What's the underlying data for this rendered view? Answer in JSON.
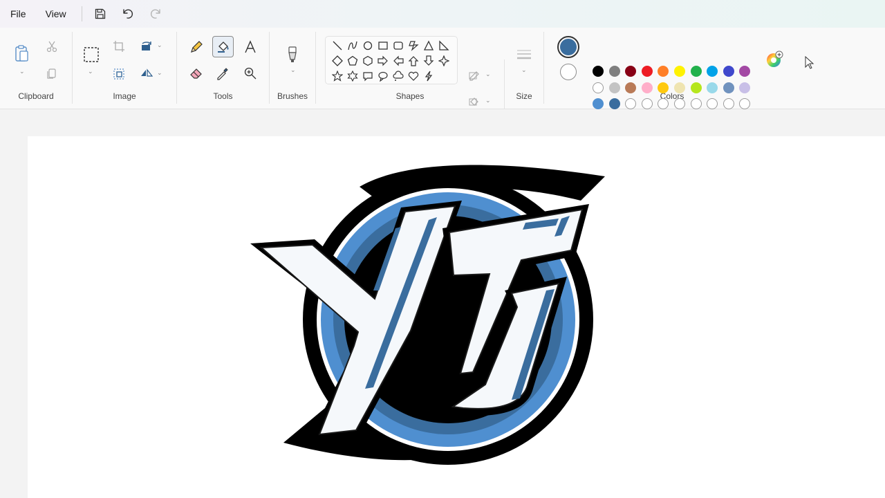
{
  "menu": {
    "file": "File",
    "view": "View"
  },
  "groups": {
    "clipboard": "Clipboard",
    "image": "Image",
    "tools": "Tools",
    "brushes": "Brushes",
    "shapes": "Shapes",
    "size": "Size",
    "colors": "Colors"
  },
  "colors": {
    "primary": "#3a6d9e",
    "secondary": "#ffffff",
    "palette_row1": [
      "#000000",
      "#7f7f7f",
      "#880015",
      "#ed1c24",
      "#ff7f27",
      "#fff200",
      "#22b14c",
      "#00a2e8",
      "#3f48cc",
      "#a349a4"
    ],
    "palette_row2": [
      "#ffffff",
      "#c3c3c3",
      "#b97a57",
      "#ffaec9",
      "#ffc90e",
      "#efe4b0",
      "#b5e61d",
      "#99d9ea",
      "#7092be",
      "#c8bfe7"
    ],
    "custom_row": [
      "#4f8fd0",
      "#3a6d9e",
      "",
      "",
      "",
      "",
      "",
      "",
      "",
      ""
    ]
  },
  "icons": {
    "save": "save-icon",
    "undo": "undo-icon",
    "redo": "redo-icon",
    "paste": "paste-icon",
    "cut": "cut-icon",
    "copy": "copy-icon",
    "select": "select-icon",
    "crop": "crop-icon",
    "resize": "resize-icon",
    "rotate": "rotate-icon",
    "flip": "flip-icon",
    "pencil": "pencil-icon",
    "fill": "fill-icon",
    "text": "text-icon",
    "eraser": "eraser-icon",
    "picker": "color-picker-icon",
    "magnifier": "magnifier-icon",
    "brush": "brush-icon",
    "outline": "outline-icon",
    "shape_fill": "shape-fill-icon",
    "size": "size-icon",
    "edit_colors": "edit-colors-icon",
    "cursor": "cursor-icon"
  },
  "shape_names": [
    "line",
    "curve",
    "oval",
    "rectangle",
    "rounded-rectangle",
    "polygon",
    "triangle",
    "right-triangle",
    "diamond",
    "pentagon",
    "hexagon",
    "right-arrow",
    "left-arrow",
    "up-arrow",
    "down-arrow",
    "four-point-star",
    "five-point-star",
    "six-point-star",
    "rect-callout",
    "oval-callout",
    "cloud-callout",
    "heart",
    "lightning"
  ]
}
